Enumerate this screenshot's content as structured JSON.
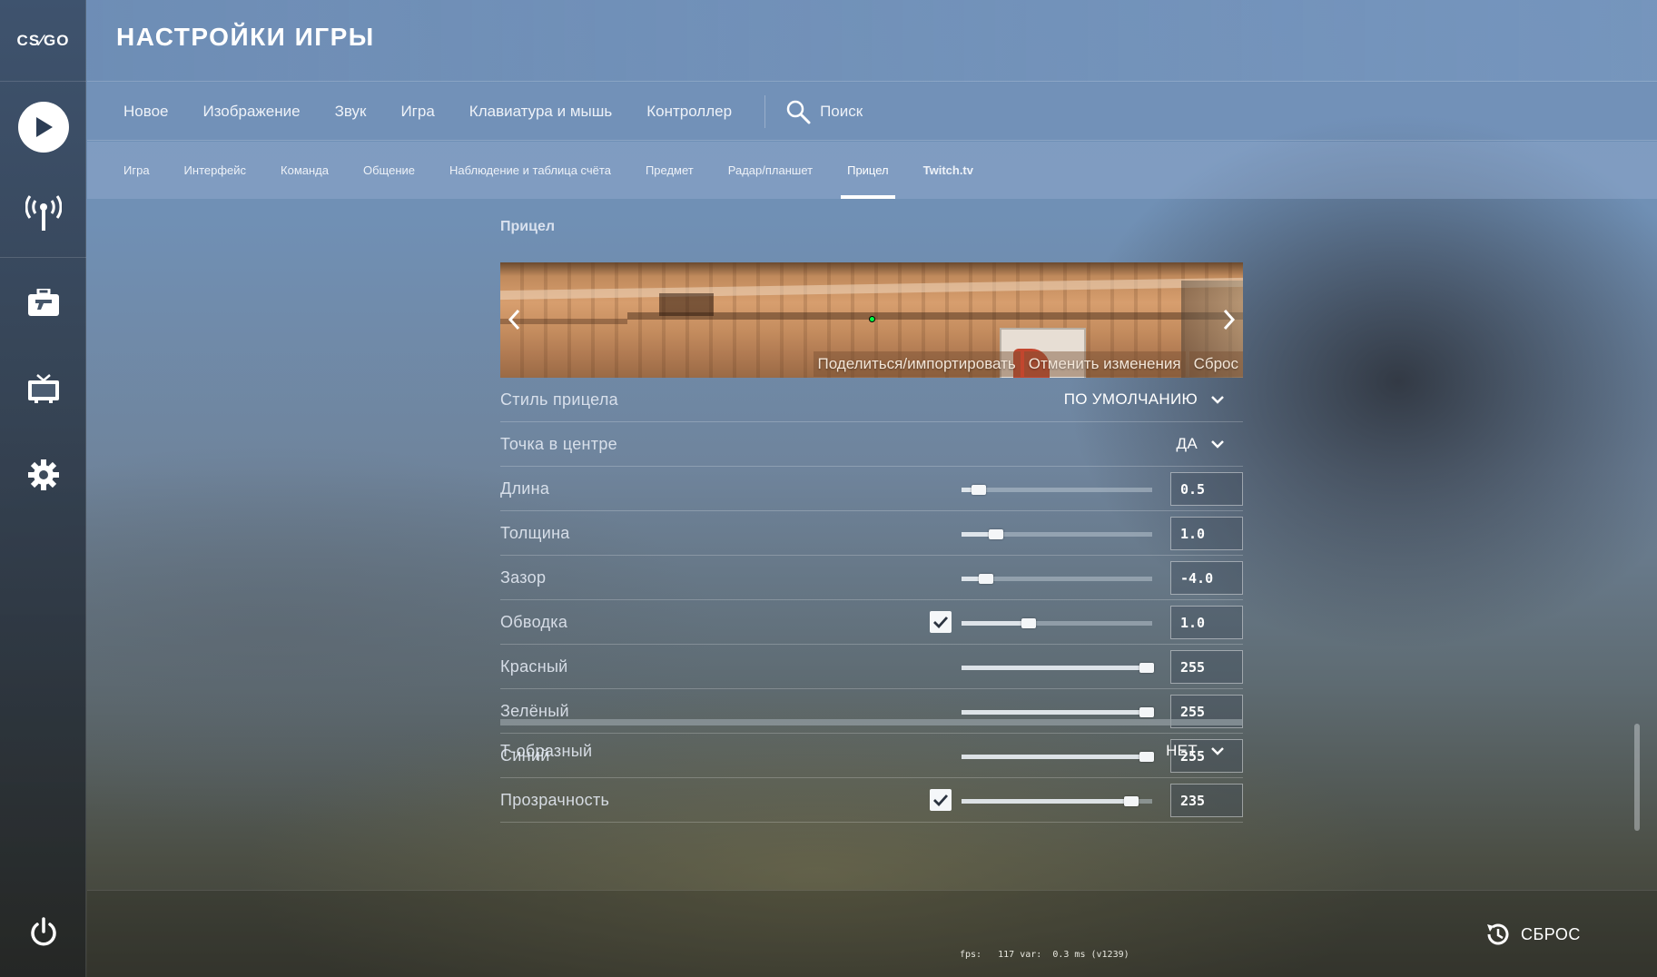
{
  "app": {
    "logo_text": "CS⁄GO"
  },
  "header": {
    "title": "НАСТРОЙКИ ИГРЫ"
  },
  "sidebar": {
    "icons": [
      "play-icon",
      "broadcast-icon",
      "briefcase-icon",
      "tv-icon",
      "gear-icon",
      "power-icon"
    ]
  },
  "nav_primary": {
    "items": [
      "Новое",
      "Изображение",
      "Звук",
      "Игра",
      "Клавиатура и мышь",
      "Контроллер"
    ],
    "search_label": "Поиск"
  },
  "nav_secondary": {
    "items": [
      "Игра",
      "Интерфейс",
      "Команда",
      "Общение",
      "Наблюдение и таблица счёта",
      "Предмет",
      "Радар/планшет",
      "Прицел",
      "Twitch.tv"
    ],
    "active": "Прицел"
  },
  "section": {
    "title": "Прицел",
    "preview_actions": [
      "Поделиться/импортировать",
      "Отменить изменения",
      "Сброс"
    ]
  },
  "settings": {
    "style": {
      "label": "Стиль прицела",
      "value": "ПО УМОЛЧАНИЮ"
    },
    "center_dot": {
      "label": "Точка в центре",
      "value": "ДА"
    },
    "sliders": [
      {
        "label": "Длина",
        "value": "0.5",
        "level": 0.09,
        "checkbox": false
      },
      {
        "label": "Толщина",
        "value": "1.0",
        "level": 0.18,
        "checkbox": false
      },
      {
        "label": "Зазор",
        "value": "-4.0",
        "level": 0.13,
        "checkbox": false
      },
      {
        "label": "Обводка",
        "value": "1.0",
        "level": 0.35,
        "checkbox": true
      },
      {
        "label": "Красный",
        "value": "255",
        "level": 0.97,
        "checkbox": false
      },
      {
        "label": "Зелёный",
        "value": "255",
        "level": 0.97,
        "checkbox": false
      },
      {
        "label": "Синий",
        "value": "255",
        "level": 0.97,
        "checkbox": false
      },
      {
        "label": "Прозрачность",
        "value": "235",
        "level": 0.89,
        "checkbox": true
      }
    ],
    "t_shape": {
      "label": "Т-образный",
      "value": "НЕТ"
    }
  },
  "footer": {
    "fps_text": "fps:   117 var:  0.3 ms (v1239)",
    "reset_label": "СБРОС"
  }
}
